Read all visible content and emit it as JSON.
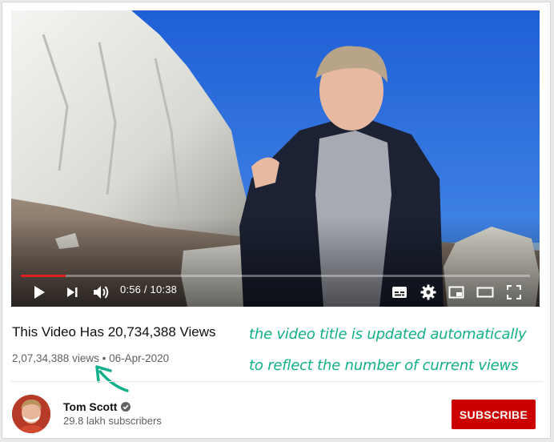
{
  "video": {
    "current_time": "0:56",
    "duration": "10:38",
    "progress_fraction": 0.088
  },
  "info": {
    "title": "This Video Has 20,734,388 Views",
    "views": "2,07,34,388 views",
    "separator": "•",
    "date": "06-Apr-2020"
  },
  "annotation": {
    "line1": "the video title is updated automatically",
    "line2": "to reflect the number of current views",
    "color": "#12b08a"
  },
  "channel": {
    "name": "Tom Scott",
    "subscribers": "29.8 lakh subscribers",
    "verified_icon": "check-circle-icon"
  },
  "actions": {
    "subscribe_label": "SUBSCRIBE",
    "subscribe_color": "#cc0000"
  },
  "controls": {
    "icons": [
      "play-icon",
      "next-icon",
      "volume-icon",
      "subtitles-icon",
      "settings-icon",
      "miniplayer-icon",
      "theater-icon",
      "fullscreen-icon"
    ]
  }
}
